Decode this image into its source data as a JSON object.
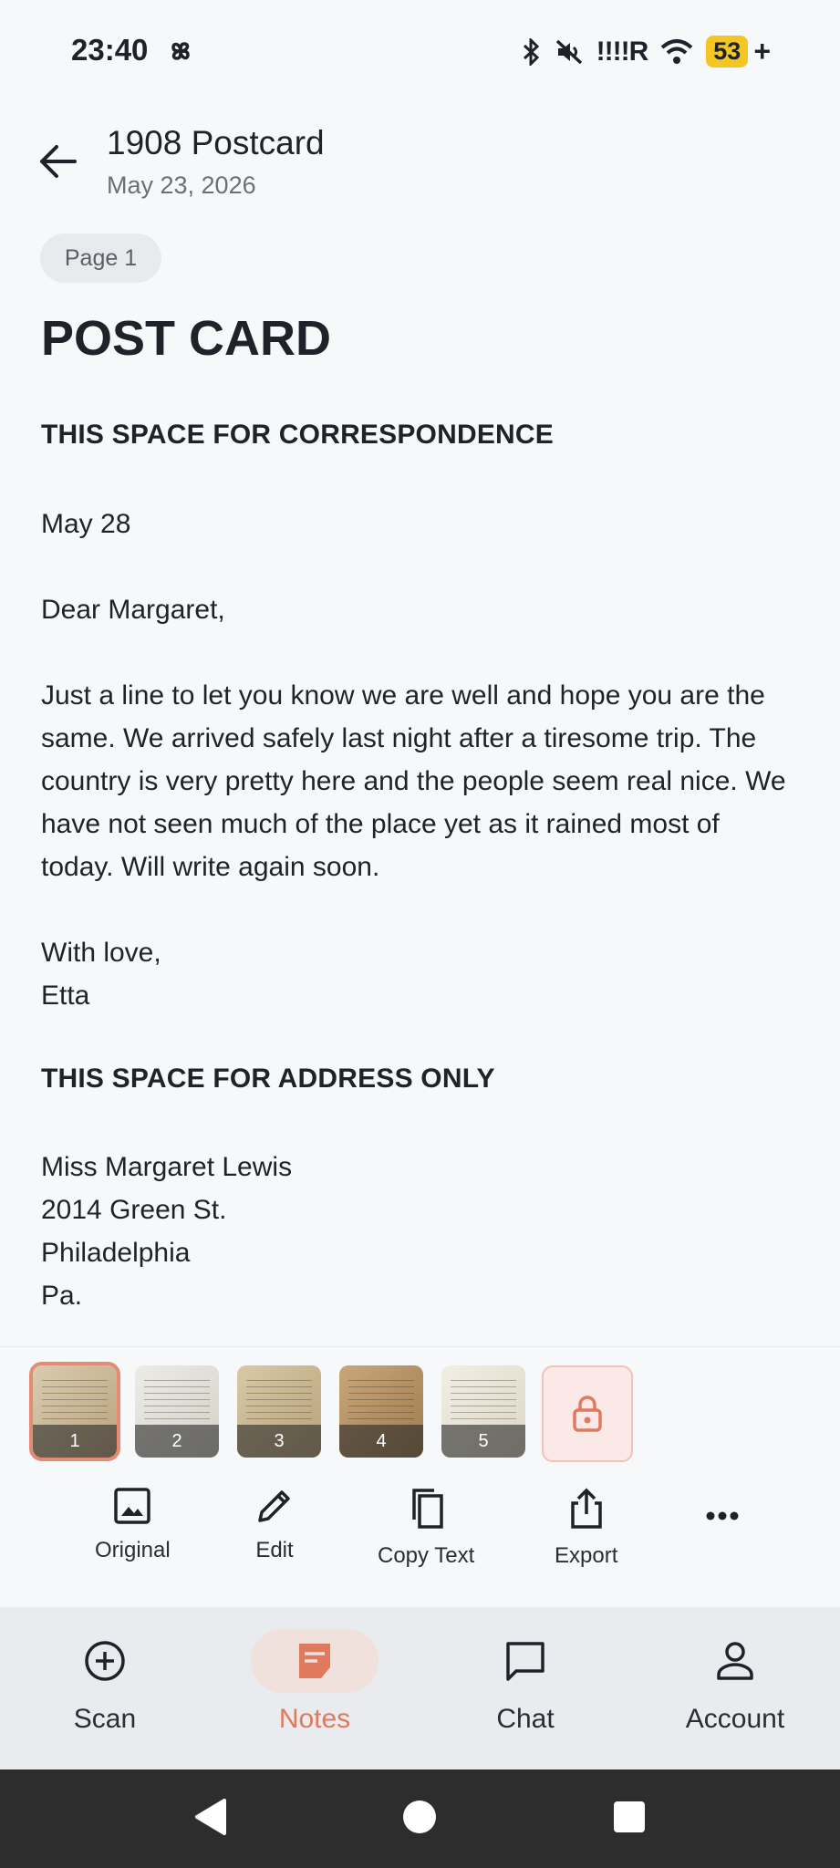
{
  "status_bar": {
    "time": "23:40",
    "network": "!!!!R",
    "battery": "53",
    "charging": "+"
  },
  "header": {
    "title": "1908 Postcard",
    "date": "May 23, 2026"
  },
  "page_chip": "Page 1",
  "document": {
    "title": "POST CARD",
    "section1": "THIS SPACE FOR CORRESPONDENCE",
    "date_line": "May 28",
    "greeting": "Dear Margaret,",
    "body": "Just a line to let you know we are well and hope you are the same. We arrived safely last night after a tiresome trip. The country is very pretty here and the people seem real nice. We have not seen much of the place yet as it rained most of today. Will write again soon.",
    "closing": "With love,",
    "signature": "Etta",
    "section2": "THIS SPACE FOR ADDRESS ONLY",
    "address_name": "Miss Margaret Lewis",
    "address_street": "2014 Green St.",
    "address_city": "Philadelphia",
    "address_state": "Pa."
  },
  "thumbnails": [
    "1",
    "2",
    "3",
    "4",
    "5"
  ],
  "actions": {
    "original": "Original",
    "edit": "Edit",
    "copy_text": "Copy Text",
    "export": "Export"
  },
  "nav": {
    "scan": "Scan",
    "notes": "Notes",
    "chat": "Chat",
    "account": "Account"
  },
  "colors": {
    "accent": "#e07a5f",
    "battery": "#f3c623",
    "nav_bg": "#e9ebee",
    "system_nav": "#2d2d2d"
  }
}
